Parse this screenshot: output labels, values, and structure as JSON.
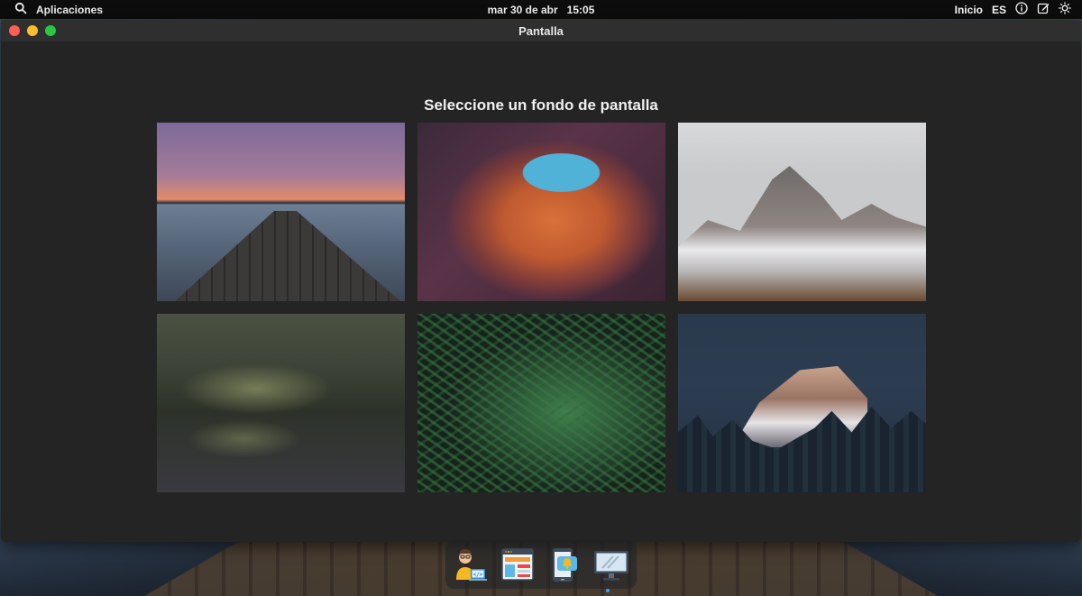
{
  "menubar": {
    "apps_label": "Aplicaciones",
    "date": "mar 30 de abr",
    "time": "15:05",
    "home_label": "Inicio",
    "language": "ES"
  },
  "window": {
    "title": "Pantalla",
    "heading": "Seleccione un fondo de pantalla"
  },
  "wallpapers": [
    {
      "icon": "pier-sunset-wallpaper"
    },
    {
      "icon": "canyon-wallpaper"
    },
    {
      "icon": "snowy-mountains-wallpaper"
    },
    {
      "icon": "misty-forest-wallpaper"
    },
    {
      "icon": "fern-wallpaper"
    },
    {
      "icon": "half-dome-night-wallpaper"
    }
  ],
  "dock": [
    {
      "icon": "developer-icon"
    },
    {
      "icon": "browser-layout-icon"
    },
    {
      "icon": "phone-notification-icon"
    },
    {
      "icon": "display-monitor-icon"
    }
  ],
  "colors": {
    "close": "#fe5f57",
    "minimize": "#febc2e",
    "maximize": "#28c840",
    "window_bg": "#242424",
    "titlebar_bg": "#2f2f2f"
  }
}
